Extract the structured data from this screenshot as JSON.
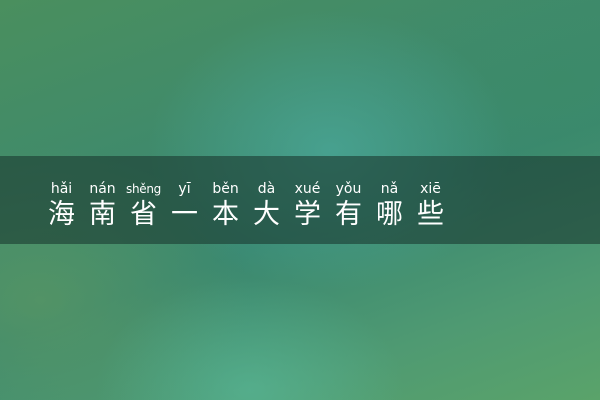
{
  "title": {
    "characters": [
      {
        "pinyin": "hǎi",
        "hanzi": "海"
      },
      {
        "pinyin": "nán",
        "hanzi": "南"
      },
      {
        "pinyin": "shěng",
        "hanzi": "省"
      },
      {
        "pinyin": "yī",
        "hanzi": "一"
      },
      {
        "pinyin": "běn",
        "hanzi": "本"
      },
      {
        "pinyin": "dà",
        "hanzi": "大"
      },
      {
        "pinyin": "xué",
        "hanzi": "学"
      },
      {
        "pinyin": "yǒu",
        "hanzi": "有"
      },
      {
        "pinyin": "nǎ",
        "hanzi": "哪"
      },
      {
        "pinyin": "xiē",
        "hanzi": "些"
      }
    ]
  },
  "colors": {
    "text": "#ffffff",
    "banner": "#1c3c32",
    "background": "#3f8a6c"
  }
}
